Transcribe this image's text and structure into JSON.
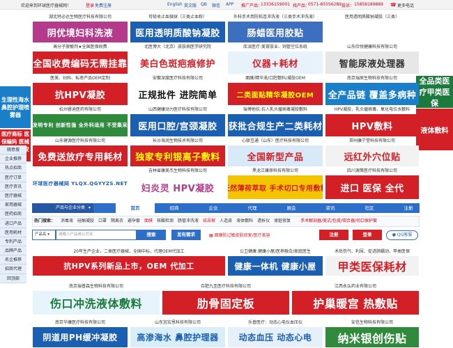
{
  "topbar": {
    "welcome": "欢迎来到环球医疗器械网！",
    "login": "登录",
    "register": "免费注册",
    "links": [
      "English",
      "英文版",
      "QB",
      "微信",
      "APP"
    ],
    "promo_label": "推广产品：",
    "phone1": "13336159001",
    "service_label": "找产品：",
    "phone2": "0571-85556289",
    "hotline_label": "投诉：",
    "phone3": "15858189889",
    "more": "更多电话"
  },
  "ad_rows": [
    [
      {
        "cap": "湖北特必达生物医疗科技有限公司",
        "text": "阴优境妇科洗液",
        "bg": "#b43a8c",
        "fg": "#ffffff"
      },
      {
        "cap": "可吸收止血微球（三类止血粉）",
        "text": "医用透明质酸钠凝胶",
        "bg": "#1b5fb3",
        "fg": "#ffffff"
      },
      {
        "cap": "外科手术用防粘连冲洗液（三类手术冲洗液）",
        "text": "肠蜡医用胶贴",
        "bg": "#3c6fc0",
        "fg": "#ffffff"
      },
      {
        "cap": "医用透明质酸钠凝胶（三类）",
        "text": "",
        "bg": "#ffffff",
        "fg": "#333333"
      }
    ],
    [
      {
        "cap": "高分子脱敏剂★全国医保收费",
        "text": "全国收费编码无需挂靠",
        "bg": "#d31f26",
        "fg": "#ffffff"
      },
      {
        "cap": "北医博大（北京）皮肤病医学研究院",
        "text": "美白色斑疤痕修护",
        "bg": "#ffffff",
        "fg": "#d31f26"
      },
      {
        "cap": "库派医疗:美育肤业、饲管空位系统",
        "text": "仪器+耗材",
        "bg": "#e8f2fb",
        "fg": "#d31f26"
      },
      {
        "cap": "山东欣悦健康科技有限公司",
        "text": "智能尿液处理器",
        "bg": "#e7e7e7",
        "fg": "#333333"
      }
    ],
    [
      {
        "cap": "医美、妇科、私密产品OEM定制",
        "text": "抗HPV凝胶",
        "bg": "#d31f26",
        "fg": "#ffffff"
      },
      {
        "cap": "安徽深度医疗科技有限公司",
        "text": "正规批件 进院简单",
        "bg": "#ffffff",
        "fg": "#111111"
      },
      {
        "cap": "面膜/精华液/口腔敷料/凝胶OEM",
        "text": "二类面贴精华凝胶OEM",
        "bg": "#d31f26",
        "fg": "#ffff00"
      },
      {
        "cap": "南京瑞辰生物科技有限公司",
        "text": "全产品链 覆盖多病种",
        "bg": "#1a7fc8",
        "fg": "#ffffff"
      }
    ],
    [
      {
        "cap": "杭州睿迪医药有限公司",
        "text": "独家发明专利 创新性强 全外科适用 不受集采影响",
        "bg": "#2f8a3c",
        "fg": "#ffffff"
      },
      {
        "cap": "山西健康动力医疗科技有限公司",
        "text": "医用口腔/宫颈凝胶",
        "bg": "#1b5fb3",
        "fg": "#ffffff"
      },
      {
        "cap": "瑞博他抗:抗人乳头瘤病毒凝胶敷料",
        "text": "获批合规生产二类耗材",
        "bg": "#1b5fb3",
        "fg": "#ffffff"
      },
      {
        "cap": "HPV凝胶，乳头瘤病毒、氧化电位水敷料",
        "text": "HPV敷料",
        "bg": "#d31f26",
        "fg": "#ffffff"
      }
    ],
    [
      {
        "cap": "山东健源医疗科技有限公司",
        "text": "免费送放疗专用耗材",
        "bg": "#d31f26",
        "fg": "#ffffff"
      },
      {
        "cap": "长沙海润生物技术有限公司",
        "text": "独家专利银离子敷料",
        "bg": "#d31f26",
        "fg": "#ffff00"
      },
      {
        "cap": "心联互通（山东）医疗科技有限公司",
        "text": "全国新型产品",
        "bg": "#d8eaf7",
        "fg": "#d31f26"
      },
      {
        "cap": "郑州康宁堂科技有限公司",
        "text": "远红外穴位贴",
        "bg": "#f2f2f2",
        "fg": "#d31f26"
      }
    ],
    [
      {
        "cap": "",
        "text": "环球医疗器械网 YLQX.QGYYZS.NET",
        "bg": "#ffffff",
        "fg": "#1b5fb3"
      },
      {
        "cap": "吉林省康美杰生物科技有限公司",
        "text": "妇炎灵 HPV凝胶",
        "bg": "#ffffff",
        "fg": "#b43a8c"
      },
      {
        "cap": "黑龙江康原科技有限公司",
        "text": "天然薄荷萃取 手术切口专用敷料",
        "bg": "#f5c400",
        "fg": "#d31f26"
      },
      {
        "cap": "四川源策医疗科技有限公司",
        "text": "进口 医保 全代",
        "bg": "#d31f26",
        "fg": "#ffffff"
      }
    ]
  ],
  "bottom_ad_rows": [
    [
      {
        "cap": "20年生产企业，二类医疗器械，全国中标，代理OEM代加工",
        "text": "抗HPV系列新品上市，OEM 代加工",
        "bg": "#d31f26",
        "fg": "#ffffff",
        "span": 2
      },
      {
        "cap": "公卫健康:健康小屋/医养融合/家庭医生",
        "text": "健康一体机 健康小屋",
        "bg": "#1b5fb3",
        "fg": "#ffffff"
      },
      {
        "cap": "术后伤气、利尿、促进肠蠕动、甲类医保",
        "text": "甲类医保耗材",
        "bg": "#f2f2f2",
        "fg": "#d31f26"
      }
    ],
    [
      {
        "cap": "南京瑞普森生物科技有限公司",
        "text": "伤口冲洗液体敷料",
        "bg": "#e8f4fb",
        "fg": "#1b7a3c"
      },
      {
        "cap": "合肥九圣医疗科技有限公司",
        "text": "肋骨固定板",
        "bg": "#d31f26",
        "fg": "#ffffff"
      },
      {
        "cap": "江西永弘药业有限公司",
        "text": "护巢暖宫 热敷贴",
        "bg": "#d31f26",
        "fg": "#ffffff"
      }
    ],
    [
      {
        "cap": "南京华康医疗科技有限公司",
        "text": "阴道用PH缓冲凝胶",
        "bg": "#1b5fb3",
        "fg": "#ffffff"
      },
      {
        "cap": "山东宜宏恩科技有限公司",
        "text": "高渗海水 鼻腔护理器",
        "bg": "#d8eef8",
        "fg": "#1b5fb3"
      },
      {
        "cap": "乐普医疗：动态心电仪血压仪",
        "text": "动态血压 动态心电",
        "bg": "#e6f0fa",
        "fg": "#1b5fb3"
      },
      {
        "cap": "安信生物科技有限公司",
        "text": "纳米银创伤贴",
        "bg": "#2f8a3c",
        "fg": "#ffffff"
      }
    ]
  ],
  "left_ads": [
    {
      "text": "生理性海水鼻腔护理喷雾器",
      "bg": "#1a7fc8"
    },
    {
      "text": "医疗商标 医保编码 医械代理 权威发布",
      "bg": "#d31f26"
    }
  ],
  "right_ads": [
    {
      "text": "全品类医疗甲类医保",
      "bg": "#1b7a3c"
    },
    {
      "text": "液体敷料",
      "bg": "#d31f26"
    }
  ],
  "left_nav": [
    "随意搜",
    "企业推荐",
    "热点招商",
    "医疗订单",
    "医疗资讯",
    "医疗器械",
    "家用器械",
    "医药招商",
    "进口产品",
    "医用耗材",
    "专利产品",
    "品牌产品",
    "名企推荐",
    "招商代理",
    "回顶部"
  ],
  "nav": {
    "category_label": "产品与企业分类",
    "tabs": [
      "首页",
      "招商",
      "企业",
      "代理",
      "展会",
      "资讯",
      "社区",
      "注册"
    ]
  },
  "hot": {
    "label": "热门搜索：",
    "words": [
      "消毒液",
      "硅酮凝胶",
      "口罩",
      "隔离衣",
      "避孕套",
      "面膜",
      "核酸检测",
      "肠管冲洗液",
      "纸尿裤",
      "人造皮",
      "液体敷料",
      "透析仪",
      "肾脏修复"
    ],
    "promo": "手术解剖器/美式/包皮/钳合器/切口保护套"
  },
  "search": {
    "type": "产品名",
    "placeholder": "请输入产品或公司名",
    "search_btn": "搜索",
    "publish_btn": "发布需求",
    "promo": "面膜防过敏皮肤修复/医疗美容",
    "reg_btn": "注册",
    "login_btn": "登录",
    "qq": "QQ客服"
  }
}
